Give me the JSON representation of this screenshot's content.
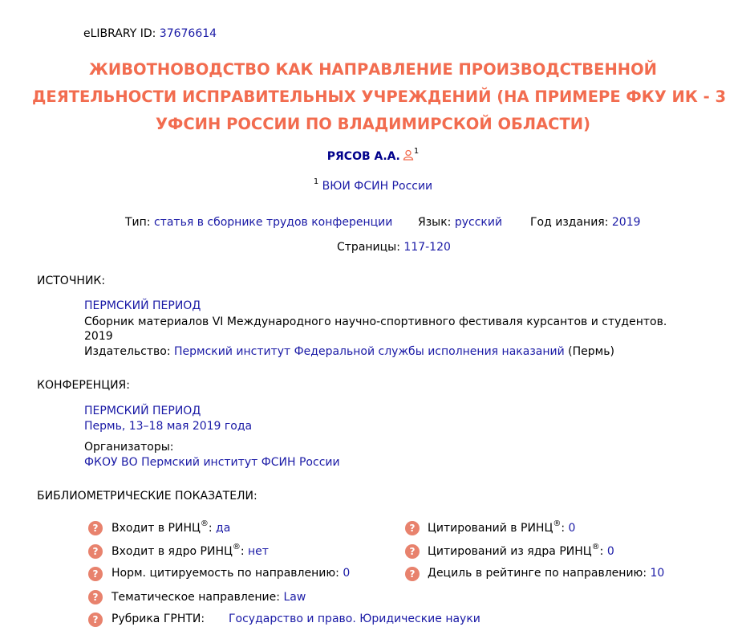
{
  "header": {
    "elibrary_label": "eLIBRARY ID:",
    "elibrary_id": "37676614"
  },
  "title_lines": [
    "ЖИВОТНОВОДСТВО КАК НАПРАВЛЕНИЕ ПРОИЗВОДСТВЕННОЙ",
    "ДЕЯТЕЛЬНОСТИ ИСПРАВИТЕЛЬНЫХ УЧРЕЖДЕНИЙ (НА ПРИМЕРЕ ФКУ ИК - 3",
    "УФСИН РОССИИ ПО ВЛАДИМИРСКОЙ ОБЛАСТИ)"
  ],
  "author": {
    "name": "РЯСОВ А.А.",
    "sup": "1",
    "icon": "person-icon"
  },
  "affiliation": {
    "sup": "1",
    "name": "ВЮИ ФСИН России"
  },
  "meta": {
    "type_label": "Тип:",
    "type_value": "статья в сборнике трудов конференции",
    "lang_label": "Язык:",
    "lang_value": "русский",
    "year_label": "Год издания:",
    "year_value": "2019",
    "pages_label": "Страницы:",
    "pages_value": "117-120"
  },
  "source": {
    "heading": "ИСТОЧНИК:",
    "title": "ПЕРМСКИЙ ПЕРИОД",
    "desc_line1": "Сборник материалов VI Международного научно-спортивного фестиваля курсантов и студентов.",
    "desc_line2": "2019",
    "publisher_label": "Издательство:",
    "publisher": "Пермский институт Федеральной службы исполнения наказаний",
    "publisher_city": "(Пермь)"
  },
  "conference": {
    "heading": "КОНФЕРЕНЦИЯ:",
    "name": "ПЕРМСКИЙ ПЕРИОД",
    "place_date": "Пермь, 13–18 мая 2019 года",
    "organizers_label": "Организаторы:",
    "organizer": "ФКОУ ВО Пермский институт ФСИН России"
  },
  "biblio": {
    "heading": "БИБЛИОМЕТРИЧЕСКИЕ ПОКАЗАТЕЛИ:",
    "help_icon": "?",
    "left": [
      {
        "label": "Входит в РИНЦ",
        "reg": "®",
        "sep": ":",
        "value": "да"
      },
      {
        "label": "Входит в ядро РИНЦ",
        "reg": "®",
        "sep": ":",
        "value": "нет"
      },
      {
        "label": "Норм. цитируемость по направлению:",
        "reg": "",
        "sep": "",
        "value": "0"
      },
      {
        "label": "Тематическое направление:",
        "reg": "",
        "sep": "",
        "value": "Law"
      },
      {
        "label": "Рубрика ГРНТИ:",
        "reg": "",
        "sep": "",
        "value": "Государство и право. Юридические науки"
      }
    ],
    "right": [
      {
        "label": "Цитирований в РИНЦ",
        "reg": "®",
        "sep": ":",
        "value": "0"
      },
      {
        "label": "Цитирований из ядра РИНЦ",
        "reg": "®",
        "sep": ":",
        "value": "0"
      },
      {
        "label": "Дециль в рейтинге по направлению:",
        "reg": "",
        "sep": "",
        "value": "10"
      }
    ]
  },
  "colors": {
    "title": "#f26c4f",
    "link": "#1a1aa6",
    "icon_bg": "#e8826d"
  }
}
